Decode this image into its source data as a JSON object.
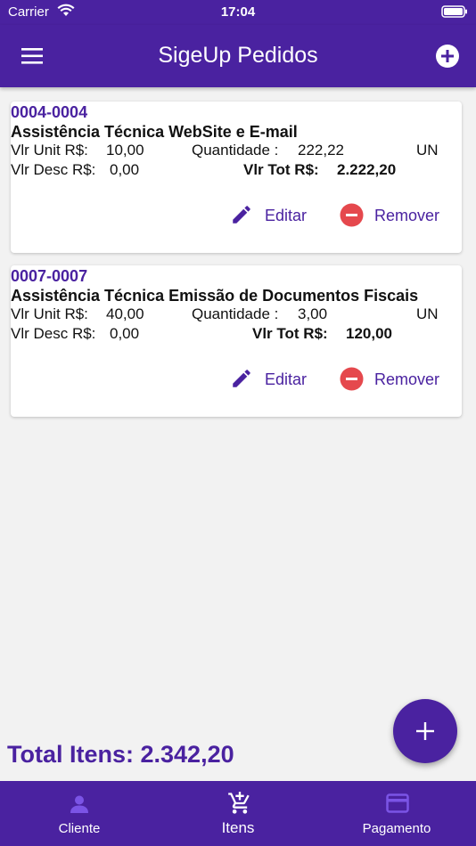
{
  "status_bar": {
    "carrier": "Carrier",
    "time": "17:04"
  },
  "app_bar": {
    "title": "SigeUp Pedidos"
  },
  "items": [
    {
      "code": "0004-0004",
      "description": "Assistência Técnica WebSite e E-mail",
      "unit_label": "Vlr Unit R$:",
      "unit_value": "10,00",
      "qty_label": "Quantidade :",
      "qty_value": "222,22",
      "unit_measure": "UN",
      "disc_label": "Vlr Desc R$:",
      "disc_value": "0,00",
      "total_label": "Vlr Tot R$:",
      "total_value": "2.222,20",
      "edit_label": "Editar",
      "remove_label": "Remover"
    },
    {
      "code": "0007-0007",
      "description": "Assistência Técnica Emissão de Documentos Fiscais",
      "unit_label": "Vlr Unit R$:",
      "unit_value": "40,00",
      "qty_label": "Quantidade :",
      "qty_value": "3,00",
      "unit_measure": "UN",
      "disc_label": "Vlr Desc R$:",
      "disc_value": "0,00",
      "total_label": "Vlr Tot R$:",
      "total_value": "120,00",
      "edit_label": "Editar",
      "remove_label": "Remover"
    }
  ],
  "footer": {
    "total": "Total Itens: 2.342,20"
  },
  "bottom_nav": [
    {
      "label": "Cliente",
      "icon": "person-icon"
    },
    {
      "label": "Itens",
      "icon": "cart-add-icon"
    },
    {
      "label": "Pagamento",
      "icon": "credit-card-icon"
    }
  ],
  "colors": {
    "primary": "#4a22a0",
    "accent": "#7b54e6",
    "danger": "#e5484d",
    "background": "#f2f2f2"
  }
}
